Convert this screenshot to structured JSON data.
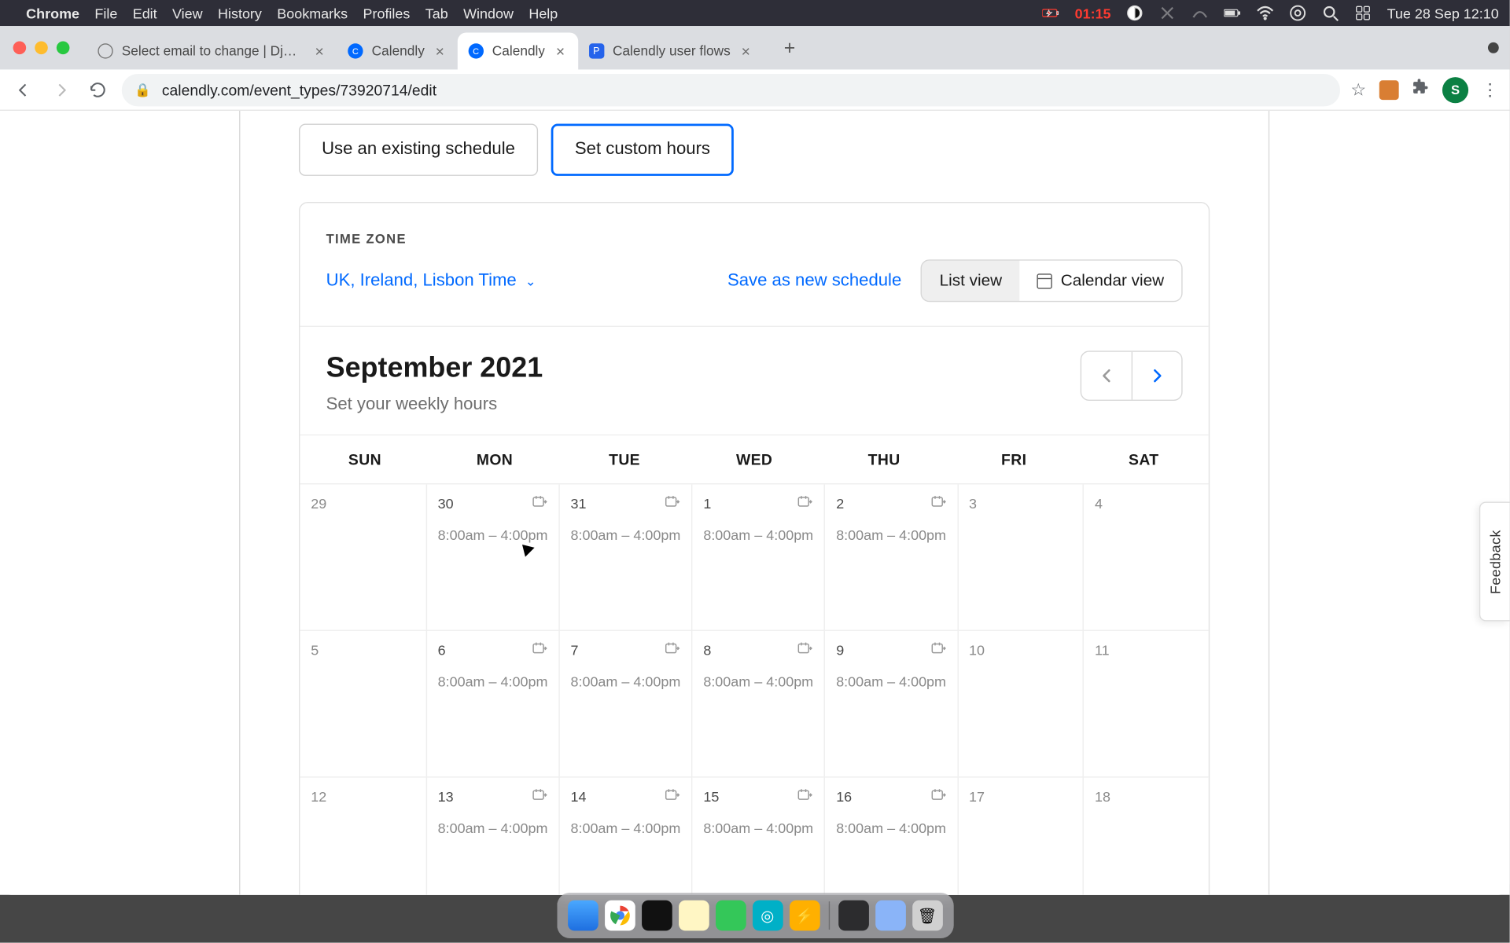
{
  "menubar": {
    "app": "Chrome",
    "items": [
      "File",
      "Edit",
      "View",
      "History",
      "Bookmarks",
      "Profiles",
      "Tab",
      "Window",
      "Help"
    ],
    "battery": "01:15",
    "datetime": "Tue 28 Sep  12:10"
  },
  "tabs": [
    {
      "title": "Select email to change | Django",
      "active": false,
      "icon": "globe"
    },
    {
      "title": "Calendly",
      "active": false,
      "icon": "cal"
    },
    {
      "title": "Calendly",
      "active": true,
      "icon": "cal"
    },
    {
      "title": "Calendly user flows",
      "active": false,
      "icon": "pf"
    }
  ],
  "url": "calendly.com/event_types/73920714/edit",
  "avatar_initial": "S",
  "segment": {
    "existing": "Use an existing schedule",
    "custom": "Set custom hours"
  },
  "timezone": {
    "label": "TIME ZONE",
    "value": "UK, Ireland, Lisbon Time"
  },
  "save_link": "Save as new schedule",
  "views": {
    "list": "List view",
    "calendar": "Calendar view"
  },
  "month": {
    "title": "September 2021",
    "sub": "Set your weekly hours"
  },
  "dow": [
    "SUN",
    "MON",
    "TUE",
    "WED",
    "THU",
    "FRI",
    "SAT"
  ],
  "hours_text": "8:00am – 4:00pm",
  "weeks": [
    [
      {
        "n": "29",
        "slot": false,
        "repeat": false
      },
      {
        "n": "30",
        "slot": true,
        "repeat": true
      },
      {
        "n": "31",
        "slot": true,
        "repeat": true
      },
      {
        "n": "1",
        "slot": true,
        "repeat": true
      },
      {
        "n": "2",
        "slot": true,
        "repeat": true
      },
      {
        "n": "3",
        "slot": false,
        "repeat": false
      },
      {
        "n": "4",
        "slot": false,
        "repeat": false
      }
    ],
    [
      {
        "n": "5",
        "slot": false,
        "repeat": false
      },
      {
        "n": "6",
        "slot": true,
        "repeat": true
      },
      {
        "n": "7",
        "slot": true,
        "repeat": true
      },
      {
        "n": "8",
        "slot": true,
        "repeat": true
      },
      {
        "n": "9",
        "slot": true,
        "repeat": true
      },
      {
        "n": "10",
        "slot": false,
        "repeat": false
      },
      {
        "n": "11",
        "slot": false,
        "repeat": false
      }
    ],
    [
      {
        "n": "12",
        "slot": false,
        "repeat": false
      },
      {
        "n": "13",
        "slot": true,
        "repeat": true
      },
      {
        "n": "14",
        "slot": true,
        "repeat": true
      },
      {
        "n": "15",
        "slot": true,
        "repeat": true
      },
      {
        "n": "16",
        "slot": true,
        "repeat": true
      },
      {
        "n": "17",
        "slot": false,
        "repeat": false
      },
      {
        "n": "18",
        "slot": false,
        "repeat": false
      }
    ]
  ],
  "feedback": "Feedback"
}
